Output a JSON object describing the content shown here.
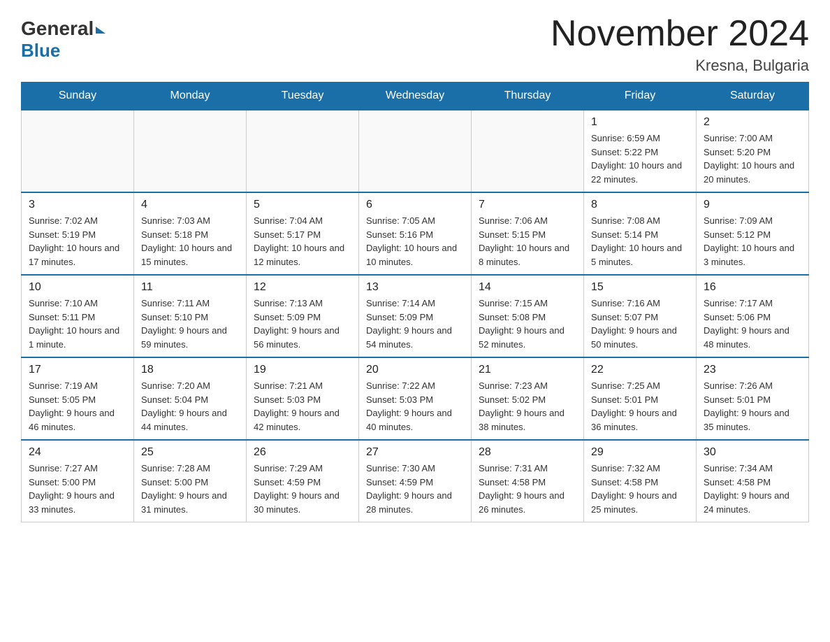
{
  "header": {
    "logo_general": "General",
    "logo_blue": "Blue",
    "main_title": "November 2024",
    "subtitle": "Kresna, Bulgaria"
  },
  "weekdays": [
    "Sunday",
    "Monday",
    "Tuesday",
    "Wednesday",
    "Thursday",
    "Friday",
    "Saturday"
  ],
  "weeks": [
    [
      {
        "day": "",
        "info": ""
      },
      {
        "day": "",
        "info": ""
      },
      {
        "day": "",
        "info": ""
      },
      {
        "day": "",
        "info": ""
      },
      {
        "day": "",
        "info": ""
      },
      {
        "day": "1",
        "info": "Sunrise: 6:59 AM\nSunset: 5:22 PM\nDaylight: 10 hours and 22 minutes."
      },
      {
        "day": "2",
        "info": "Sunrise: 7:00 AM\nSunset: 5:20 PM\nDaylight: 10 hours and 20 minutes."
      }
    ],
    [
      {
        "day": "3",
        "info": "Sunrise: 7:02 AM\nSunset: 5:19 PM\nDaylight: 10 hours and 17 minutes."
      },
      {
        "day": "4",
        "info": "Sunrise: 7:03 AM\nSunset: 5:18 PM\nDaylight: 10 hours and 15 minutes."
      },
      {
        "day": "5",
        "info": "Sunrise: 7:04 AM\nSunset: 5:17 PM\nDaylight: 10 hours and 12 minutes."
      },
      {
        "day": "6",
        "info": "Sunrise: 7:05 AM\nSunset: 5:16 PM\nDaylight: 10 hours and 10 minutes."
      },
      {
        "day": "7",
        "info": "Sunrise: 7:06 AM\nSunset: 5:15 PM\nDaylight: 10 hours and 8 minutes."
      },
      {
        "day": "8",
        "info": "Sunrise: 7:08 AM\nSunset: 5:14 PM\nDaylight: 10 hours and 5 minutes."
      },
      {
        "day": "9",
        "info": "Sunrise: 7:09 AM\nSunset: 5:12 PM\nDaylight: 10 hours and 3 minutes."
      }
    ],
    [
      {
        "day": "10",
        "info": "Sunrise: 7:10 AM\nSunset: 5:11 PM\nDaylight: 10 hours and 1 minute."
      },
      {
        "day": "11",
        "info": "Sunrise: 7:11 AM\nSunset: 5:10 PM\nDaylight: 9 hours and 59 minutes."
      },
      {
        "day": "12",
        "info": "Sunrise: 7:13 AM\nSunset: 5:09 PM\nDaylight: 9 hours and 56 minutes."
      },
      {
        "day": "13",
        "info": "Sunrise: 7:14 AM\nSunset: 5:09 PM\nDaylight: 9 hours and 54 minutes."
      },
      {
        "day": "14",
        "info": "Sunrise: 7:15 AM\nSunset: 5:08 PM\nDaylight: 9 hours and 52 minutes."
      },
      {
        "day": "15",
        "info": "Sunrise: 7:16 AM\nSunset: 5:07 PM\nDaylight: 9 hours and 50 minutes."
      },
      {
        "day": "16",
        "info": "Sunrise: 7:17 AM\nSunset: 5:06 PM\nDaylight: 9 hours and 48 minutes."
      }
    ],
    [
      {
        "day": "17",
        "info": "Sunrise: 7:19 AM\nSunset: 5:05 PM\nDaylight: 9 hours and 46 minutes."
      },
      {
        "day": "18",
        "info": "Sunrise: 7:20 AM\nSunset: 5:04 PM\nDaylight: 9 hours and 44 minutes."
      },
      {
        "day": "19",
        "info": "Sunrise: 7:21 AM\nSunset: 5:03 PM\nDaylight: 9 hours and 42 minutes."
      },
      {
        "day": "20",
        "info": "Sunrise: 7:22 AM\nSunset: 5:03 PM\nDaylight: 9 hours and 40 minutes."
      },
      {
        "day": "21",
        "info": "Sunrise: 7:23 AM\nSunset: 5:02 PM\nDaylight: 9 hours and 38 minutes."
      },
      {
        "day": "22",
        "info": "Sunrise: 7:25 AM\nSunset: 5:01 PM\nDaylight: 9 hours and 36 minutes."
      },
      {
        "day": "23",
        "info": "Sunrise: 7:26 AM\nSunset: 5:01 PM\nDaylight: 9 hours and 35 minutes."
      }
    ],
    [
      {
        "day": "24",
        "info": "Sunrise: 7:27 AM\nSunset: 5:00 PM\nDaylight: 9 hours and 33 minutes."
      },
      {
        "day": "25",
        "info": "Sunrise: 7:28 AM\nSunset: 5:00 PM\nDaylight: 9 hours and 31 minutes."
      },
      {
        "day": "26",
        "info": "Sunrise: 7:29 AM\nSunset: 4:59 PM\nDaylight: 9 hours and 30 minutes."
      },
      {
        "day": "27",
        "info": "Sunrise: 7:30 AM\nSunset: 4:59 PM\nDaylight: 9 hours and 28 minutes."
      },
      {
        "day": "28",
        "info": "Sunrise: 7:31 AM\nSunset: 4:58 PM\nDaylight: 9 hours and 26 minutes."
      },
      {
        "day": "29",
        "info": "Sunrise: 7:32 AM\nSunset: 4:58 PM\nDaylight: 9 hours and 25 minutes."
      },
      {
        "day": "30",
        "info": "Sunrise: 7:34 AM\nSunset: 4:58 PM\nDaylight: 9 hours and 24 minutes."
      }
    ]
  ]
}
